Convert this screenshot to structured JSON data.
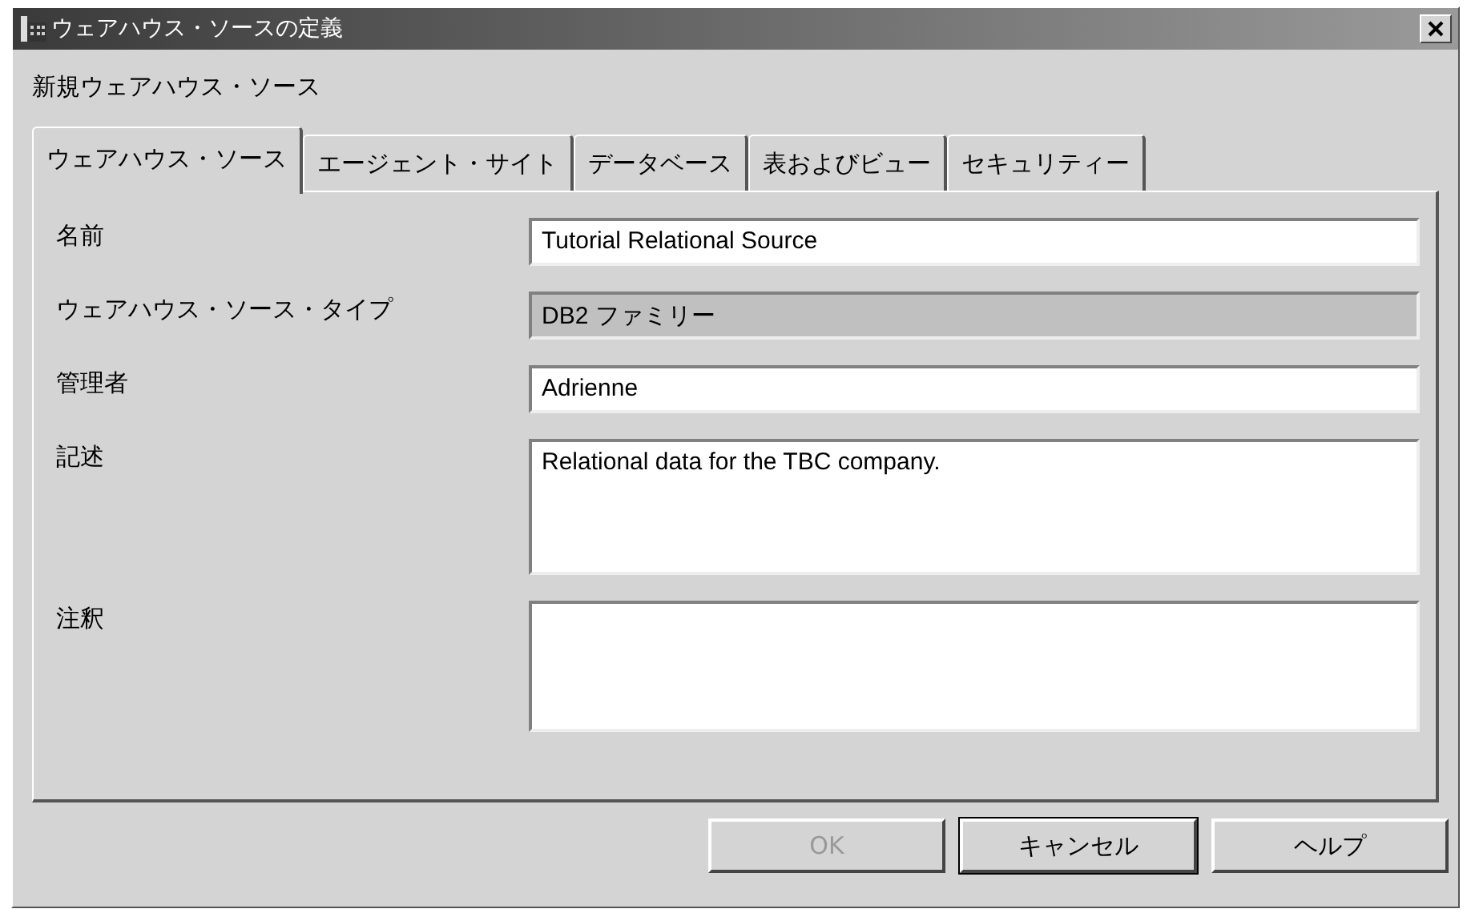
{
  "window": {
    "title": "ウェアハウス・ソースの定義"
  },
  "subtitle": "新規ウェアハウス・ソース",
  "tabs": [
    {
      "label": "ウェアハウス・ソース",
      "selected": true
    },
    {
      "label": "エージェント・サイト",
      "selected": false
    },
    {
      "label": "データベース",
      "selected": false
    },
    {
      "label": "表およびビュー",
      "selected": false
    },
    {
      "label": "セキュリティー",
      "selected": false
    }
  ],
  "fields": [
    {
      "label": "名前",
      "kind": "single",
      "value": "Tutorial Relational Source",
      "disabled": false
    },
    {
      "label": "ウェアハウス・ソース・タイプ",
      "kind": "single",
      "value": "DB2 ファミリー",
      "disabled": true
    },
    {
      "label": "管理者",
      "kind": "single",
      "value": "Adrienne",
      "disabled": false
    },
    {
      "label": "記述",
      "kind": "multi",
      "value": "Relational data for the TBC company.",
      "disabled": false
    },
    {
      "label": "注釈",
      "kind": "multi",
      "disabled": false
    }
  ],
  "buttons": [
    {
      "label": "OK",
      "disabled": true,
      "default": false
    },
    {
      "label": "キャンセル",
      "disabled": false,
      "default": true
    },
    {
      "label": "ヘルプ",
      "disabled": false,
      "default": false
    }
  ]
}
